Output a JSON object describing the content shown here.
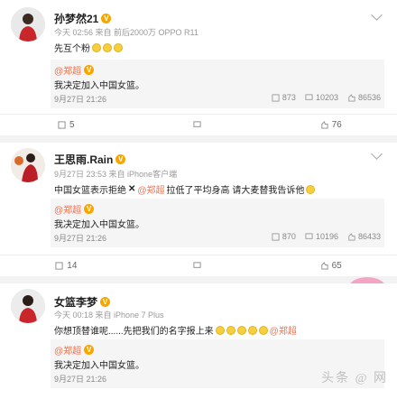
{
  "posts": [
    {
      "username": "孙梦然21",
      "meta": "今天 02:56 来自 前后2000万 OPPO R11",
      "content": "先互个粉",
      "repost": {
        "user": "@郑超",
        "text": "我决定加入中国女篮。",
        "date": "9月27日 21:26",
        "stats": [
          "873",
          "10203",
          "86536"
        ]
      },
      "actions": [
        "5",
        "",
        "76"
      ]
    },
    {
      "username": "王思雨.Rain",
      "meta": "9月27日 23:53 来自 iPhone客户端",
      "content_before": "中国女篮表示拒绝",
      "content_mention": "@郑超",
      "content_after": "拉低了平均身高  请大麦替我告诉他",
      "repost": {
        "user": "@郑超",
        "text": "我决定加入中国女篮。",
        "date": "9月27日 21:26",
        "stats": [
          "870",
          "10196",
          "86433"
        ]
      },
      "actions": [
        "14",
        "",
        "65"
      ]
    },
    {
      "username": "女篮李梦",
      "meta": "今天 00:18 来自 iPhone 7 Plus",
      "content_before": "你想顶替谁呢......先把我们的名字报上来",
      "content_mention": "@郑超",
      "repost": {
        "user": "@郑超",
        "text": "我决定加入中国女篮。",
        "date": "9月27日 21:26"
      }
    }
  ],
  "watermark": "头条 @ 网",
  "colors": {
    "mention": "#eb7350",
    "badge": "#f7a600"
  }
}
